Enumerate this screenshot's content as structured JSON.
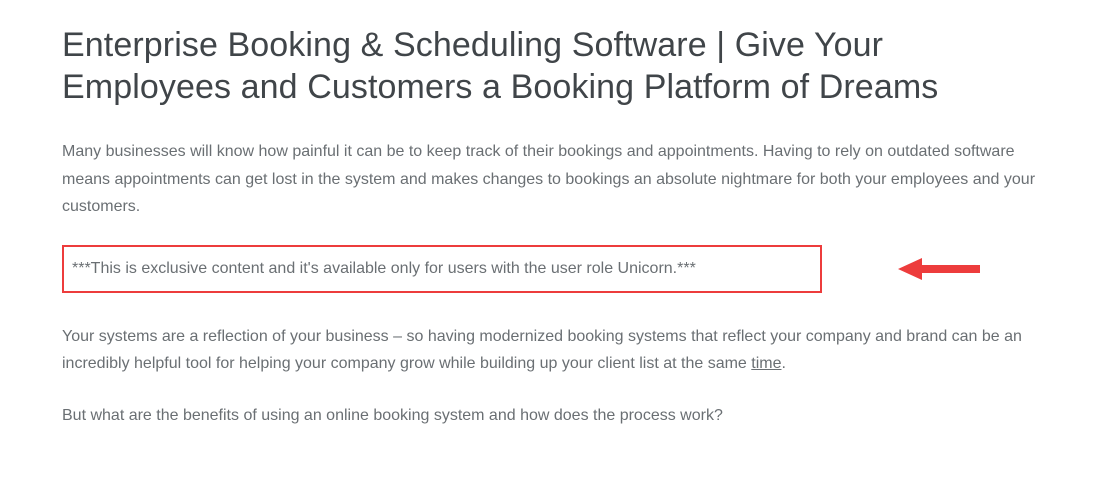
{
  "article": {
    "title": "Enterprise Booking & Scheduling Software | Give Your Employees and Customers a Booking Platform of Dreams",
    "paragraph1": "Many businesses will know how painful it can be to keep track of their bookings and appointments. Having to rely on outdated software means appointments can get lost in the system and makes changes to bookings an absolute nightmare for both your employees and your customers.",
    "callout": "***This is exclusive content and it's available only for users with the user role Unicorn.***",
    "paragraph2_prefix": "Your systems are a reflection of your business – so having modernized booking systems that reflect your company and brand can be an incredibly helpful tool for helping your company grow while building up your client list at the same ",
    "paragraph2_underlined": "time",
    "paragraph2_suffix": ".",
    "paragraph3": "But what are the benefits of using an online booking system and how does the process work?"
  },
  "annotation": {
    "highlight_color": "#ed3c3c",
    "arrow_color": "#ed3c3c"
  }
}
